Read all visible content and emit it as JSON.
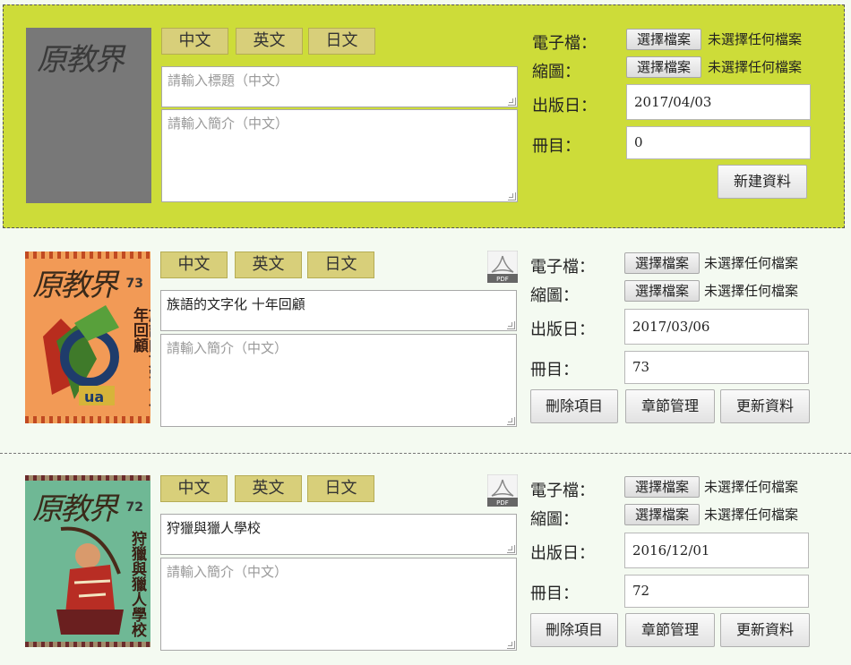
{
  "lang_buttons": [
    "中文",
    "英文",
    "日文"
  ],
  "labels": {
    "efile": "電子檔：",
    "thumb": "縮圖：",
    "pubdate": "出版日：",
    "volume": "冊目："
  },
  "file": {
    "choose_label": "選擇檔案",
    "no_file": "未選擇任何檔案"
  },
  "placeholders": {
    "title": "請輸入標題（中文）",
    "intro": "請輸入簡介（中文）"
  },
  "new_entry": {
    "cover_text": "原教界",
    "pubdate": "2017/04/03",
    "volume": "0",
    "create_label": "新建資料"
  },
  "entries": [
    {
      "title": "族語的文字化 十年回顧",
      "pubdate": "2017/03/06",
      "volume": "73",
      "cover": {
        "logo": "原教界",
        "issue": "73",
        "headline": "族語的文字化十年回顧"
      }
    },
    {
      "title": "狩獵與獵人學校",
      "pubdate": "2016/12/01",
      "volume": "72",
      "cover": {
        "logo": "原教界",
        "issue": "72",
        "headline": "狩獵與獵人學校"
      }
    }
  ],
  "actions": {
    "delete": "刪除項目",
    "chapters": "章節管理",
    "update": "更新資料"
  },
  "pdf_icon_text": "PDF",
  "colors": {
    "new_bg": "#cddc39",
    "page_bg": "#f4faf1",
    "lang_btn": "#d8cf7a"
  }
}
